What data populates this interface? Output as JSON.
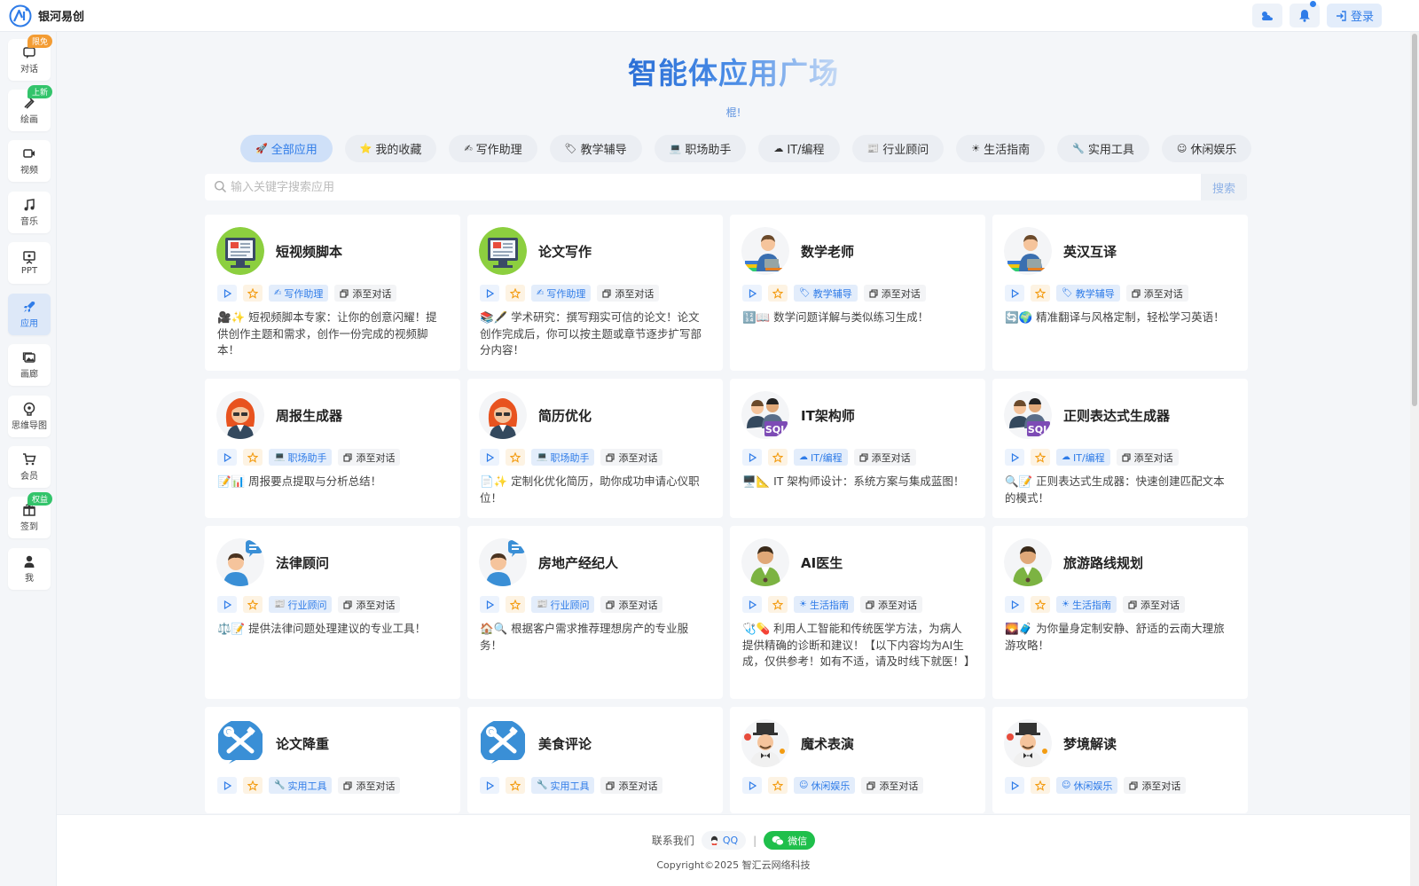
{
  "app": {
    "name": "银河易创"
  },
  "header": {
    "login_label": "登录"
  },
  "sidebar": {
    "items": [
      {
        "label": "对话",
        "icon": "chat-icon",
        "badge": "限免",
        "badge_color": "#f39c33"
      },
      {
        "label": "绘画",
        "icon": "brush-icon",
        "badge": "上新",
        "badge_color": "#33c46b"
      },
      {
        "label": "视频",
        "icon": "video-icon"
      },
      {
        "label": "音乐",
        "icon": "music-icon"
      },
      {
        "label": "PPT",
        "icon": "ppt-icon"
      },
      {
        "label": "应用",
        "icon": "rocket-icon",
        "active": true
      },
      {
        "label": "画廊",
        "icon": "gallery-icon"
      },
      {
        "label": "思维导图",
        "icon": "mindmap-icon"
      },
      {
        "label": "会员",
        "icon": "cart-icon"
      },
      {
        "label": "签到",
        "icon": "gift-icon",
        "badge": "权益",
        "badge_color": "#33c46b"
      },
      {
        "label": "我",
        "icon": "user-icon"
      }
    ]
  },
  "main": {
    "title": "智能体应用广场",
    "subtitle": "棍!",
    "categories": [
      {
        "label": "全部应用",
        "icon": "🚀",
        "active": true
      },
      {
        "label": "我的收藏",
        "icon": "⭐"
      },
      {
        "label": "写作助理",
        "icon": "✍"
      },
      {
        "label": "教学辅导",
        "icon": "🏷"
      },
      {
        "label": "职场助手",
        "icon": "💻"
      },
      {
        "label": "IT/编程",
        "icon": "☁"
      },
      {
        "label": "行业顾问",
        "icon": "📰"
      },
      {
        "label": "生活指南",
        "icon": "☀"
      },
      {
        "label": "实用工具",
        "icon": "🔧"
      },
      {
        "label": "休闲娱乐",
        "icon": "☺"
      }
    ],
    "search": {
      "placeholder": "输入关键字搜索应用",
      "button_label": "搜索"
    },
    "add_label": "添至对话",
    "apps": [
      {
        "title": "短视频脚本",
        "tag": "写作助理",
        "tag_icon": "✍",
        "avatar": "monitor",
        "desc": "🎥✨ 短视频脚本专家：让你的创意闪耀！提供创作主题和需求，创作一份完成的视频脚本！"
      },
      {
        "title": "论文写作",
        "tag": "写作助理",
        "tag_icon": "✍",
        "avatar": "monitor",
        "desc": "📚🖋️ 学术研究：撰写翔实可信的论文！论文创作完成后，你可以按主题或章节逐步扩写部分内容！"
      },
      {
        "title": "数学老师",
        "tag": "教学辅导",
        "tag_icon": "🏷",
        "avatar": "teacher",
        "desc": "🔢📖 数学问题详解与类似练习生成！"
      },
      {
        "title": "英汉互译",
        "tag": "教学辅导",
        "tag_icon": "🏷",
        "avatar": "teacher",
        "desc": "🔄🌍 精准翻译与风格定制，轻松学习英语！"
      },
      {
        "title": "周报生成器",
        "tag": "职场助手",
        "tag_icon": "💻",
        "avatar": "redhair",
        "desc": "📝📊 周报要点提取与分析总结！"
      },
      {
        "title": "简历优化",
        "tag": "职场助手",
        "tag_icon": "💻",
        "avatar": "redhair",
        "desc": "📄✨ 定制化优化简历，助你成功申请心仪职位！"
      },
      {
        "title": "IT架构师",
        "tag": "IT/编程",
        "tag_icon": "☁",
        "avatar": "sql",
        "desc": "🖥️📐 IT 架构师设计：系统方案与集成蓝图！"
      },
      {
        "title": "正则表达式生成器",
        "tag": "IT/编程",
        "tag_icon": "☁",
        "avatar": "sql",
        "desc": "🔍📝 正则表达式生成器：快速创建匹配文本的模式！"
      },
      {
        "title": "法律顾问",
        "tag": "行业顾问",
        "tag_icon": "📰",
        "avatar": "bubble",
        "desc": "⚖️📝 提供法律问题处理建议的专业工具！"
      },
      {
        "title": "房地产经纪人",
        "tag": "行业顾问",
        "tag_icon": "📰",
        "avatar": "bubble",
        "desc": "🏠🔍 根据客户需求推荐理想房产的专业服务！"
      },
      {
        "title": "AI医生",
        "tag": "生活指南",
        "tag_icon": "☀",
        "avatar": "doctor",
        "desc": "🩺💊 利用人工智能和传统医学方法，为病人提供精确的诊断和建议！【以下内容均为AI生成，仅供参考！如有不适，请及时线下就医！】"
      },
      {
        "title": "旅游路线规划",
        "tag": "生活指南",
        "tag_icon": "☀",
        "avatar": "doctor",
        "desc": "🌄🧳 为你量身定制安静、舒适的云南大理旅游攻略！"
      },
      {
        "title": "论文降重",
        "tag": "实用工具",
        "tag_icon": "🔧",
        "avatar": "tools",
        "desc": ""
      },
      {
        "title": "美食评论",
        "tag": "实用工具",
        "tag_icon": "🔧",
        "avatar": "tools",
        "desc": ""
      },
      {
        "title": "魔术表演",
        "tag": "休闲娱乐",
        "tag_icon": "☺",
        "avatar": "magician",
        "desc": ""
      },
      {
        "title": "梦境解读",
        "tag": "休闲娱乐",
        "tag_icon": "☺",
        "avatar": "magician",
        "desc": ""
      }
    ]
  },
  "footer": {
    "contact_label": "联系我们",
    "qq_label": "QQ",
    "separator": "|",
    "wechat_label": "微信",
    "copyright": "Copyright©2025 智汇云网络科技"
  },
  "colors": {
    "accent": "#2f7ce8",
    "wechat": "#1fbf4b",
    "badge_orange": "#f39c33",
    "badge_green": "#33c46b"
  }
}
